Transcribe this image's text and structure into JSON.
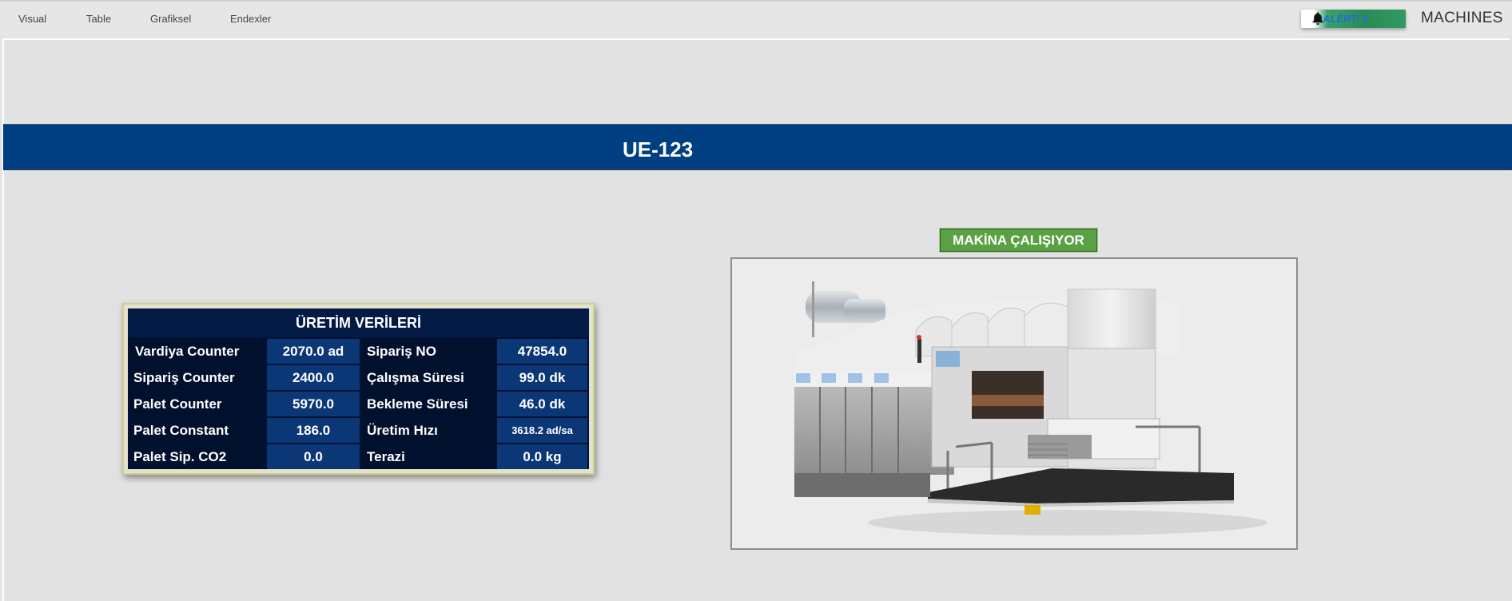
{
  "nav": {
    "items": [
      "Visual",
      "Table",
      "Grafiksel",
      "Endexler"
    ]
  },
  "alert": {
    "text": "ALERT: 0",
    "icon": "bell-icon",
    "color": "#2f9a62"
  },
  "header": {
    "machines_label": "MACHINES"
  },
  "machine": {
    "name": "UE-123",
    "status": "MAKİNA ÇALIŞIYOR",
    "status_color": "#5aa143"
  },
  "production": {
    "title": "ÜRETİM VERİLERİ",
    "rows": [
      {
        "label1": "Vardiya Counter",
        "value1": "2070.0 ad",
        "label2": "Sipariş NO",
        "value2": "47854.0"
      },
      {
        "label1": "Sipariş Counter",
        "value1": "2400.0",
        "label2": "Çalışma Süresi",
        "value2": "99.0 dk"
      },
      {
        "label1": "Palet Counter",
        "value1": "5970.0",
        "label2": "Bekleme Süresi",
        "value2": "46.0 dk"
      },
      {
        "label1": "Palet Constant",
        "value1": "186.0",
        "label2": "Üretim Hızı",
        "value2": "3618.2 ad/sa"
      },
      {
        "label1": "Palet Sip. CO2",
        "value1": "0.0",
        "label2": "Terazi",
        "value2": "0.0 kg"
      }
    ]
  },
  "colors": {
    "title_band": "#003f82",
    "table_bg": "#011233",
    "table_value_bg": "#0b3776"
  }
}
